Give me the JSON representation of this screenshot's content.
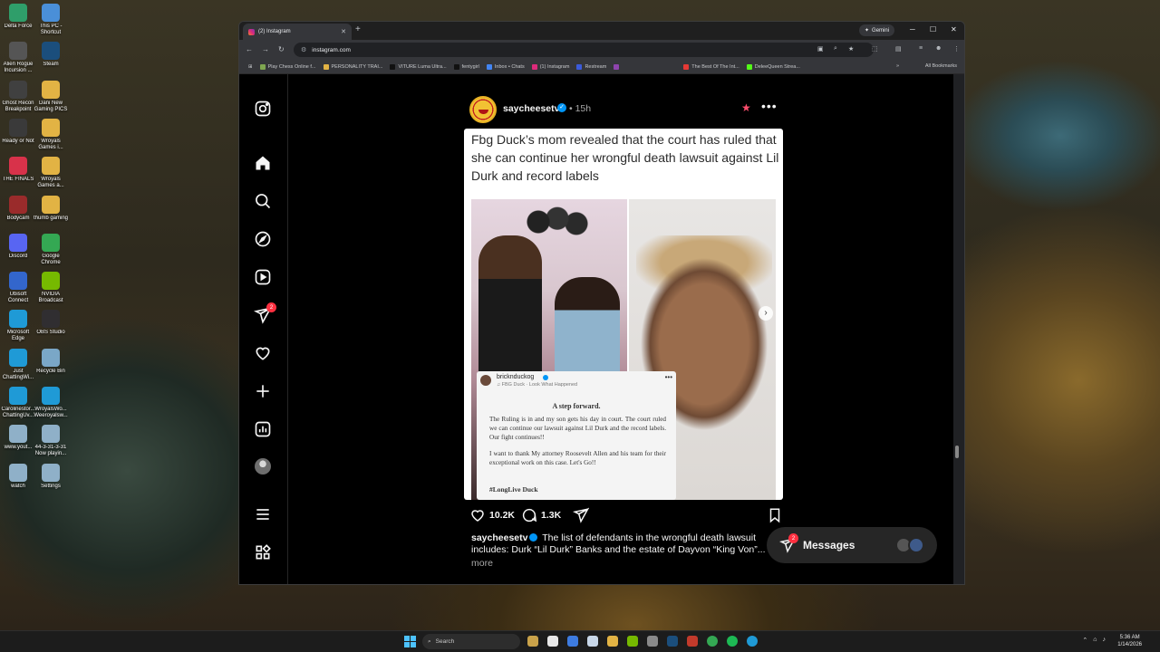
{
  "desktop": {
    "icons": [
      {
        "label": "Delta Force",
        "color": "#2f9e6a"
      },
      {
        "label": "This PC - Shortcut",
        "color": "#4a8fd8"
      },
      {
        "label": "Alien Rogue Incursion ...",
        "color": "#555555"
      },
      {
        "label": "Steam",
        "color": "#1b4e7c"
      },
      {
        "label": "Ghost Recon Breakpoint",
        "color": "#404040"
      },
      {
        "label": "Dani New Gaming PICS",
        "color": "#e2b344"
      },
      {
        "label": "Ready or Not",
        "color": "#3a3a3a"
      },
      {
        "label": "Wroyals Games i...",
        "color": "#e2b344"
      },
      {
        "label": "THE FINALS",
        "color": "#d8324a"
      },
      {
        "label": "Wroyals Games a...",
        "color": "#e2b344"
      },
      {
        "label": "Bodycam",
        "color": "#9a2b2b"
      },
      {
        "label": "thumb gaming",
        "color": "#e2b344"
      },
      {
        "label": "Discord",
        "color": "#5865f2"
      },
      {
        "label": "Google Chrome",
        "color": "#34a853"
      },
      {
        "label": "Ubisoft Connect",
        "color": "#3366cc"
      },
      {
        "label": "NVIDIA Broadcast",
        "color": "#76b900"
      },
      {
        "label": "Microsoft Edge",
        "color": "#1f9ad6"
      },
      {
        "label": "OBS Studio",
        "color": "#302e31"
      },
      {
        "label": "Just ChattingWi...",
        "color": "#1f9ad6"
      },
      {
        "label": "Recycle Bin",
        "color": "#7aa7c7"
      },
      {
        "label": "Carolinestor... ChattingUv...",
        "color": "#1f9ad6"
      },
      {
        "label": "WroyalsWo... Weeroyalsw...",
        "color": "#1f9ad6"
      },
      {
        "label": "www.yout...",
        "color": "#8fb0c8"
      },
      {
        "label": "44-3-31-3-31 Now playin...",
        "color": "#8fb0c8"
      },
      {
        "label": "watch",
        "color": "#8fb0c8"
      },
      {
        "label": "Settings",
        "color": "#8fb0c8"
      }
    ]
  },
  "browser": {
    "tab_title": "(2) Instagram",
    "tab_close": "✕",
    "new_tab": "+",
    "gemini_label": "Gemini",
    "window_controls": {
      "minimize": "─",
      "maximize": "☐",
      "close": "✕"
    },
    "nav": {
      "back": "←",
      "forward": "→",
      "reload": "↻"
    },
    "address": "instagram.com",
    "bookmarks": [
      {
        "label": "Play Chess Online f...",
        "color": "#7fa650"
      },
      {
        "label": "PERSONALITY TRAI...",
        "color": "#e2b344"
      },
      {
        "label": "VITURE Luma Ultra...",
        "color": "#111111"
      },
      {
        "label": "fentygirl",
        "color": "#111111"
      },
      {
        "label": "Inbox • Chats",
        "color": "#4285f4"
      },
      {
        "label": "(1) Instagram",
        "color": "#dd2a7b"
      },
      {
        "label": "Restream",
        "color": "#3b5bdb"
      },
      {
        "label": "",
        "color": "#8e44ad"
      },
      {
        "label": "The Best Of The Int...",
        "color": "#e53935"
      },
      {
        "label": "DeleeQueen Strea...",
        "color": "#53fc18"
      }
    ],
    "more_bookmarks": "»",
    "all_bookmarks": "All Bookmarks"
  },
  "instagram": {
    "notifications_count": "2",
    "post": {
      "username": "saycheesetv",
      "time": "• 15h",
      "more": "•••",
      "headline": "Fbg Duck’s mom revealed that the court has ruled that she can continue her wrongful death lawsuit against Lil Durk and record labels",
      "statement": {
        "user": "bricknduckog",
        "song": "♫ FBG Duck · Look What Happened",
        "more": "•••",
        "heading": "A step forward.",
        "body1": "The Ruling is in and my son gets his day in court. The court ruled we can continue our lawsuit against Lil Durk and the record labels. Our fight continues!!",
        "body2": "I want to thank My attorney Roosevelt Allen and his team for their exceptional work on this case. Let's Go!!",
        "tag": "#LongLive Duck"
      },
      "next": "›",
      "likes": "10.2K",
      "comments": "1.3K",
      "caption": "The list of defendants in the wrongful death lawsuit includes: Durk “Lil Durk” Banks and the estate of Dayvon “King Von”...",
      "caption_more": "more"
    },
    "messages": {
      "label": "Messages",
      "badge": "2"
    }
  },
  "taskbar": {
    "search_placeholder": "Search",
    "time": "5:36 AM",
    "date": "1/14/2026"
  }
}
